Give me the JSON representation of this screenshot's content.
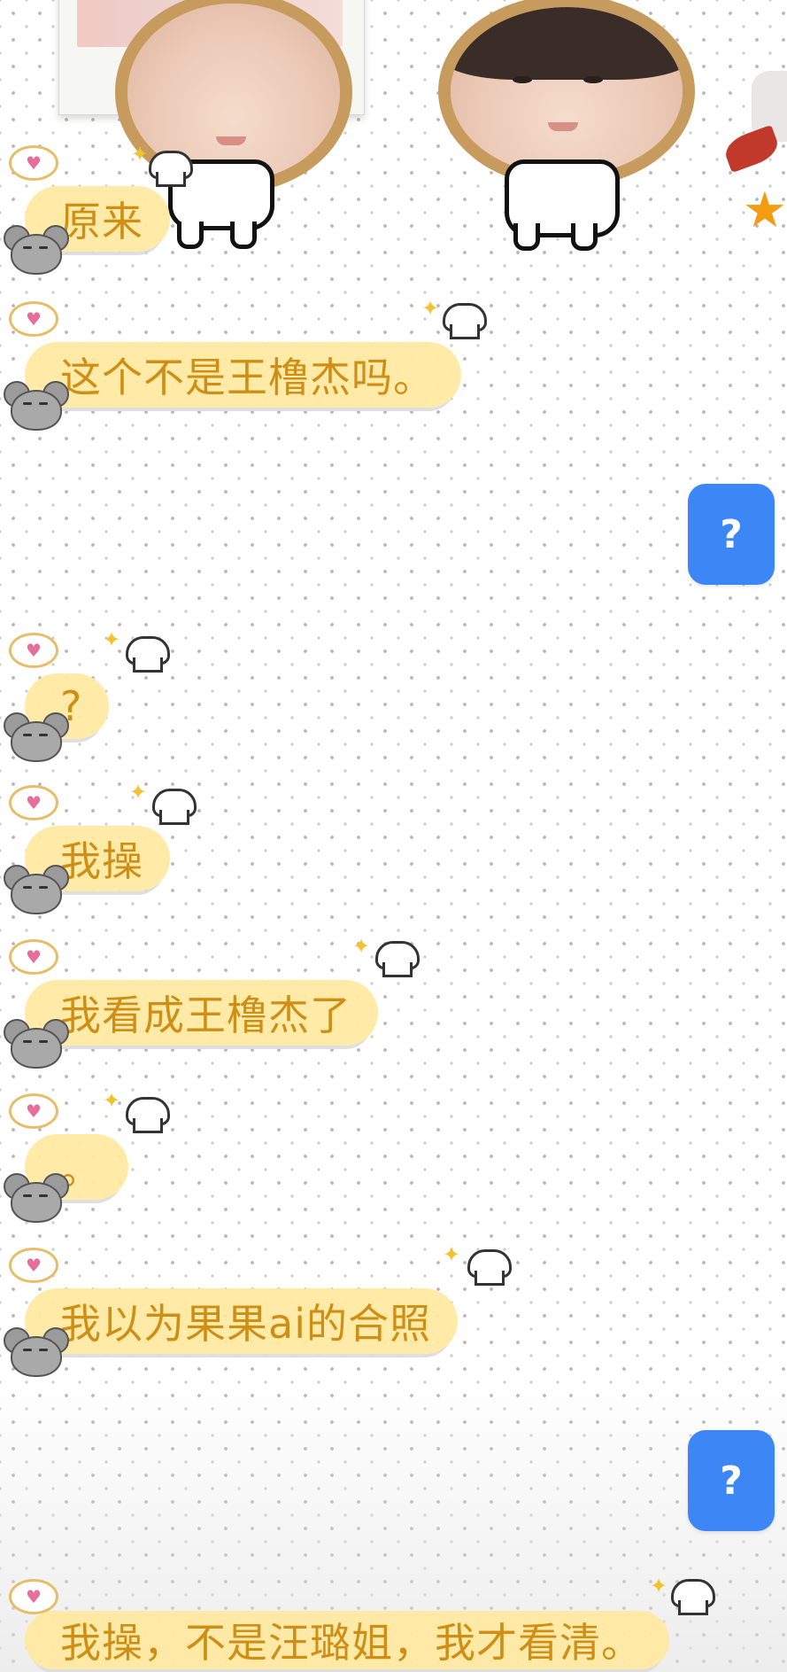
{
  "messages": [
    {
      "text": "原来"
    },
    {
      "text": "这个不是王橹杰吗。"
    },
    {
      "text": "?"
    },
    {
      "text": "我操"
    },
    {
      "text": "我看成王橹杰了"
    },
    {
      "text": "。"
    },
    {
      "text": "我以为果果ai的合照"
    },
    {
      "text": "我操，不是汪璐姐，我才看清。"
    }
  ],
  "right_buttons": [
    {
      "label": "?"
    },
    {
      "label": "?"
    }
  ],
  "colors": {
    "bubble": "#ffe9a0",
    "bubble_text": "#cf8f16",
    "button_blue": "#3d86f5"
  },
  "icons": {
    "heart": "heart-icon",
    "mouse": "mouse-avatar-icon",
    "chef_hat": "chef-hat-icon",
    "sparkle": "sparkle-icon",
    "star": "star-icon"
  },
  "glyphs": {
    "heart": "♥",
    "sparkle": "✦",
    "star": "★"
  }
}
